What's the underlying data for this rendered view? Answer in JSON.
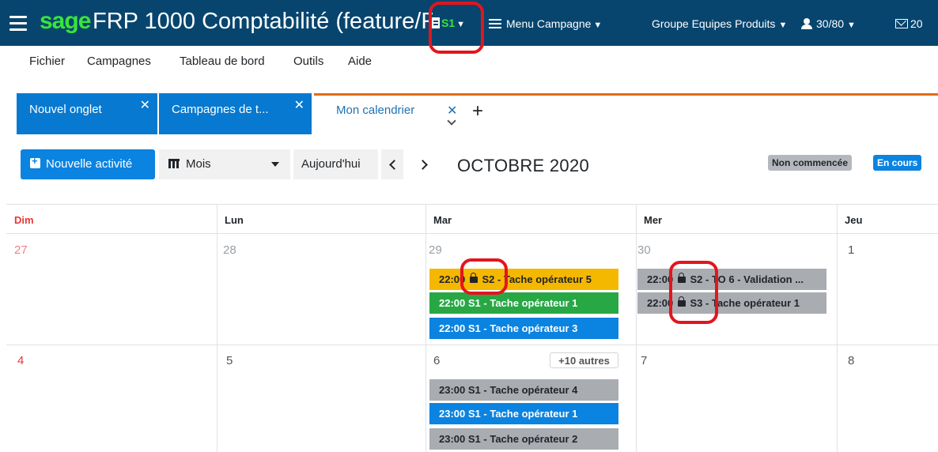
{
  "header": {
    "brand": "sage",
    "app_title": "FRP 1000 Comptabilité (feature/F",
    "site": "S1",
    "campaign_menu": "Menu Campagne",
    "group": "Groupe Equipes Produits",
    "users": "30/80",
    "mail_count": "20"
  },
  "menubar": [
    "Fichier",
    "Campagnes",
    "Tableau de bord",
    "Outils",
    "Aide"
  ],
  "tabs": [
    {
      "label": "Nouvel onglet"
    },
    {
      "label": "Campagnes de t..."
    },
    {
      "label": "Mon calendrier"
    }
  ],
  "toolbar": {
    "new_activity": "Nouvelle activité",
    "view": "Mois",
    "today": "Aujourd'hui",
    "month_title": "OCTOBRE 2020"
  },
  "legend": [
    "Non commencée",
    "En cours"
  ],
  "calendar": {
    "day_headers": [
      "Dim",
      "Lun",
      "Mar",
      "Mer",
      "Jeu"
    ],
    "week1_days": [
      "27",
      "28",
      "29",
      "30",
      "1"
    ],
    "week2_days": [
      "4",
      "5",
      "6",
      "7",
      "8"
    ],
    "more": "+10 autres",
    "events": {
      "tue29": [
        {
          "time": "22:00",
          "site": "S2",
          "title": "Tache opérateur 5",
          "locked": true,
          "color": "#f5b800"
        },
        {
          "time": "22:00",
          "site": "S1",
          "title": "Tache opérateur 1",
          "locked": false,
          "color": "#28a745"
        },
        {
          "time": "22:00",
          "site": "S1",
          "title": "Tache opérateur 3",
          "locked": false,
          "color": "#0b83e0"
        }
      ],
      "wed30": [
        {
          "time": "22:00",
          "site": "S2",
          "title": "TO 6 - Validation ...",
          "locked": true,
          "color": "#a9adb2"
        },
        {
          "time": "22:00",
          "site": "S3",
          "title": "Tache opérateur 1",
          "locked": true,
          "color": "#a9adb2"
        }
      ],
      "tue6": [
        {
          "time": "23:00",
          "site": "S1",
          "title": "Tache opérateur 4",
          "locked": false,
          "color": "#a9adb2"
        },
        {
          "time": "23:00",
          "site": "S1",
          "title": "Tache opérateur 1",
          "locked": false,
          "color": "#0b83e0"
        },
        {
          "time": "23:00",
          "site": "S1",
          "title": "Tache opérateur 2",
          "locked": false,
          "color": "#a9adb2"
        }
      ]
    }
  },
  "colors": {
    "header_bg": "#07456e",
    "brand_green": "#39e43b",
    "tab_blue": "#0779d0",
    "active_tab_accent": "#e06c17",
    "annotation_red": "#e3151d"
  }
}
